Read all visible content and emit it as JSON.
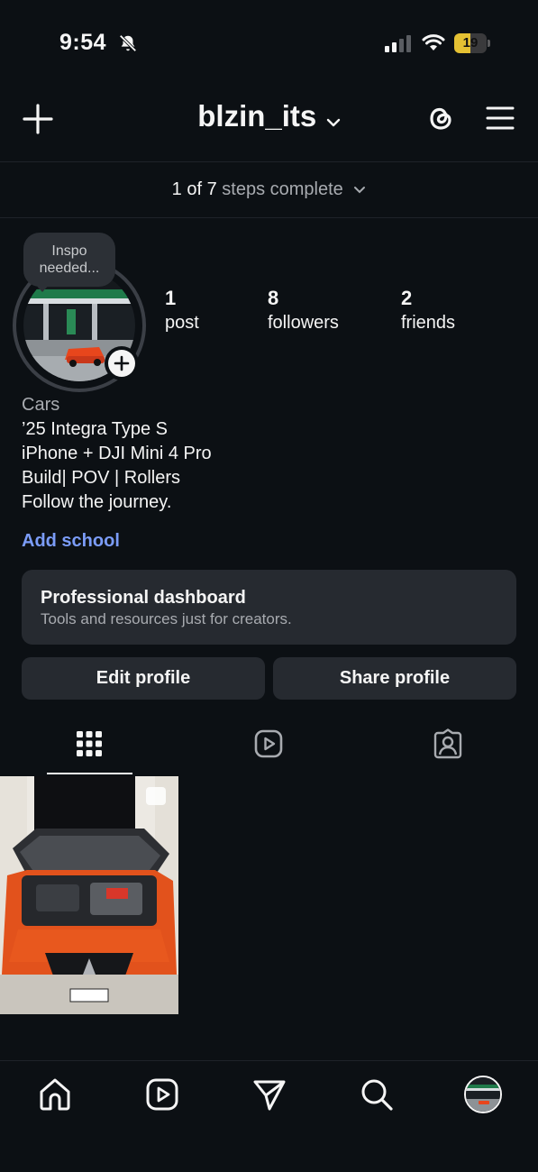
{
  "status": {
    "time": "9:54",
    "battery": "19",
    "battery_level": 0.19
  },
  "header": {
    "username": "blzin_its"
  },
  "steps": {
    "done": "1 of 7",
    "rest": "steps complete"
  },
  "avatar": {
    "note_line1": "Inspo",
    "note_line2": "needed..."
  },
  "stats": [
    {
      "num": "1",
      "label": "post"
    },
    {
      "num": "8",
      "label": "followers"
    },
    {
      "num": "2",
      "label": "friends"
    }
  ],
  "bio": {
    "category": "Cars",
    "lines": [
      "’25 Integra Type S",
      "iPhone + DJI Mini 4 Pro",
      "Build| POV | Rollers",
      "Follow the journey."
    ],
    "add_school": "Add school"
  },
  "dashboard": {
    "title": "Professional dashboard",
    "subtitle": "Tools and resources just for creators."
  },
  "buttons": {
    "edit": "Edit profile",
    "share": "Share profile"
  },
  "colors": {
    "background": "#0c1014",
    "card": "#262a30",
    "link": "#7b9cf8",
    "muted": "#a8abb0"
  }
}
